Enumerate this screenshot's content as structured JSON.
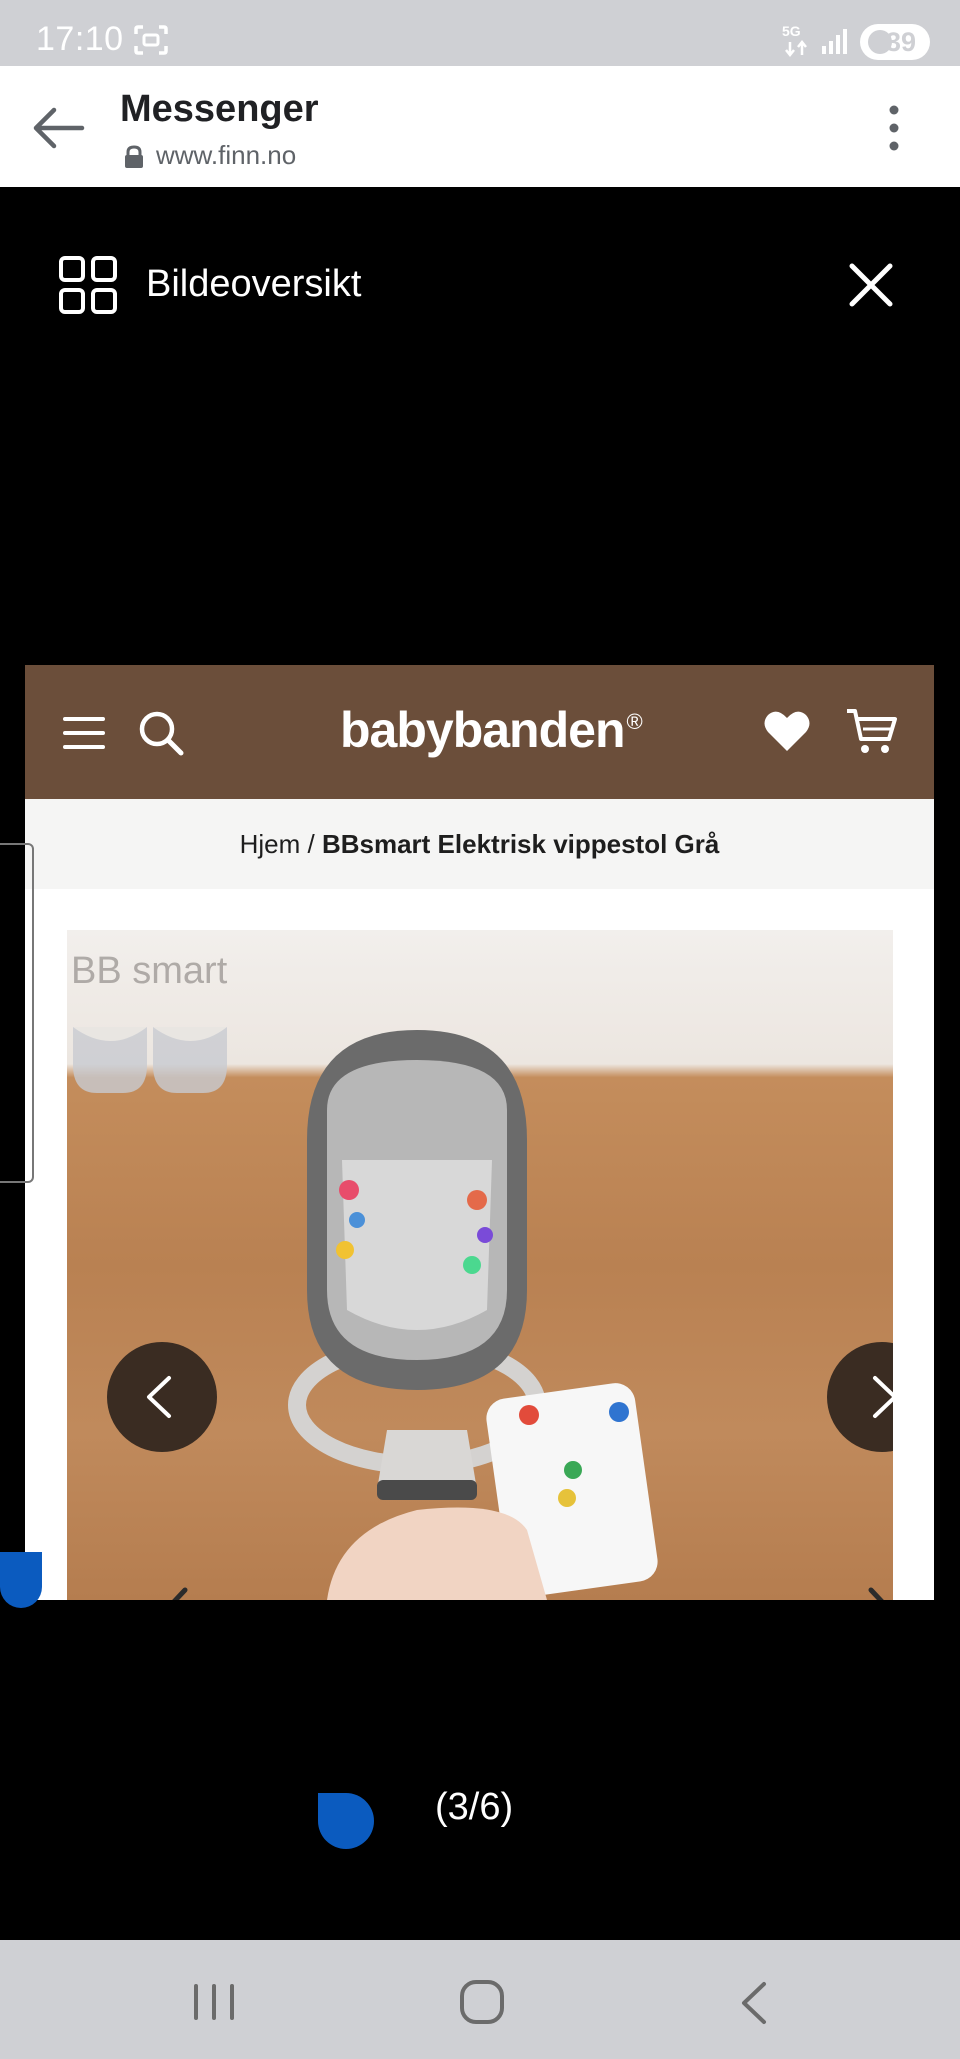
{
  "status_bar": {
    "time": "17:10",
    "battery": "39",
    "network": "5G"
  },
  "browser": {
    "title": "Messenger",
    "url": "www.finn.no"
  },
  "viewer": {
    "overview_label": "Bildeoversikt",
    "counter": "(3/6)"
  },
  "site": {
    "logo": "babybanden",
    "logo_mark": "®",
    "breadcrumb_home": "Hjem",
    "breadcrumb_separator": " / ",
    "breadcrumb_current": "BBsmart Elektrisk vippestol Grå",
    "photo_brand": "BB smart"
  },
  "colors": {
    "site_header": "#6b4e3a",
    "gallery_button": "#3a2c22",
    "accent_blue": "#0b5bbf",
    "system_bar": "#cfd0d4"
  },
  "icons": {
    "back": "arrow-left-icon",
    "lock": "lock-icon",
    "more": "more-vertical-icon",
    "overview": "grid-icon",
    "close": "close-icon",
    "menu": "menu-icon",
    "search": "search-icon",
    "wishlist": "heart-icon",
    "cart": "cart-icon"
  }
}
